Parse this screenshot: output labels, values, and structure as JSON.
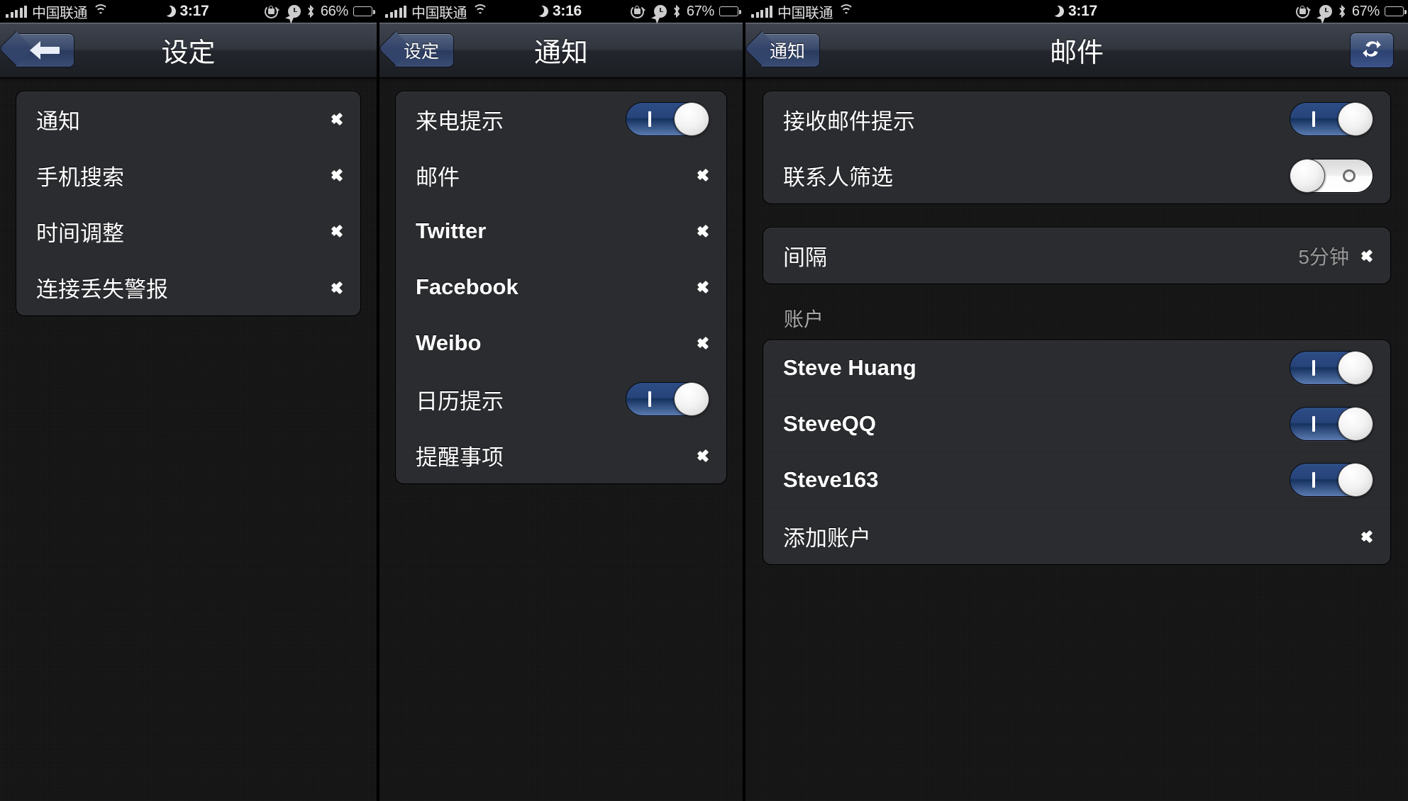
{
  "theme": {
    "accent_blue": "#2c4b86",
    "row_bg": "#2b2c30",
    "screen_bg": "#131314",
    "text_primary": "#ffffff",
    "text_secondary": "#9b9b9b"
  },
  "panels": [
    {
      "id": "settings",
      "statusbar": {
        "carrier": "中国联通",
        "time": "3:17",
        "battery_percent": "66%",
        "icons": [
          "signal-bars-icon",
          "wifi-icon",
          "moon-icon",
          "rotation-lock-icon",
          "location-arrow-icon",
          "alarm-clock-icon",
          "bluetooth-icon",
          "battery-icon"
        ]
      },
      "navbar": {
        "title": "设定",
        "back_label": "",
        "back_icon": "back-arrow-icon",
        "right_button": null
      },
      "groups": [
        {
          "rows": [
            {
              "label": "通知",
              "type": "disclosure"
            },
            {
              "label": "手机搜索",
              "type": "disclosure"
            },
            {
              "label": "时间调整",
              "type": "disclosure"
            },
            {
              "label": "连接丢失警报",
              "type": "disclosure"
            }
          ]
        }
      ]
    },
    {
      "id": "notifications",
      "statusbar": {
        "carrier": "中国联通",
        "time": "3:16",
        "battery_percent": "67%",
        "icons": [
          "signal-bars-icon",
          "wifi-icon",
          "moon-icon",
          "rotation-lock-icon",
          "location-arrow-icon",
          "alarm-clock-icon",
          "bluetooth-icon",
          "battery-icon"
        ]
      },
      "navbar": {
        "title": "通知",
        "back_label": "设定",
        "back_icon": "back-chevron-icon",
        "right_button": null
      },
      "groups": [
        {
          "rows": [
            {
              "label": "来电提示",
              "type": "toggle",
              "value": "on"
            },
            {
              "label": "邮件",
              "type": "disclosure"
            },
            {
              "label": "Twitter",
              "type": "disclosure",
              "latin": true
            },
            {
              "label": "Facebook",
              "type": "disclosure",
              "latin": true
            },
            {
              "label": "Weibo",
              "type": "disclosure",
              "latin": true
            },
            {
              "label": "日历提示",
              "type": "toggle",
              "value": "on"
            },
            {
              "label": "提醒事项",
              "type": "disclosure"
            }
          ]
        }
      ]
    },
    {
      "id": "mail",
      "statusbar": {
        "carrier": "中国联通",
        "time": "3:17",
        "battery_percent": "67%",
        "icons": [
          "signal-bars-icon",
          "wifi-icon",
          "moon-icon",
          "rotation-lock-icon",
          "location-arrow-icon",
          "alarm-clock-icon",
          "bluetooth-icon",
          "battery-icon"
        ]
      },
      "navbar": {
        "title": "邮件",
        "back_label": "通知",
        "back_icon": "back-chevron-icon",
        "right_button": {
          "icon": "refresh-sync-icon"
        }
      },
      "groups": [
        {
          "rows": [
            {
              "label": "接收邮件提示",
              "type": "toggle",
              "value": "on"
            },
            {
              "label": "联系人筛选",
              "type": "toggle",
              "value": "off"
            }
          ]
        },
        {
          "rows": [
            {
              "label": "间隔",
              "type": "disclosure",
              "value": "5分钟"
            }
          ]
        },
        {
          "header": "账户",
          "rows": [
            {
              "label": "Steve Huang",
              "type": "toggle",
              "value": "on",
              "latin": true
            },
            {
              "label": "SteveQQ",
              "type": "toggle",
              "value": "on",
              "latin": true
            },
            {
              "label": "Steve163",
              "type": "toggle",
              "value": "on",
              "latin": true
            },
            {
              "label": "添加账户",
              "type": "disclosure"
            }
          ]
        }
      ]
    }
  ]
}
